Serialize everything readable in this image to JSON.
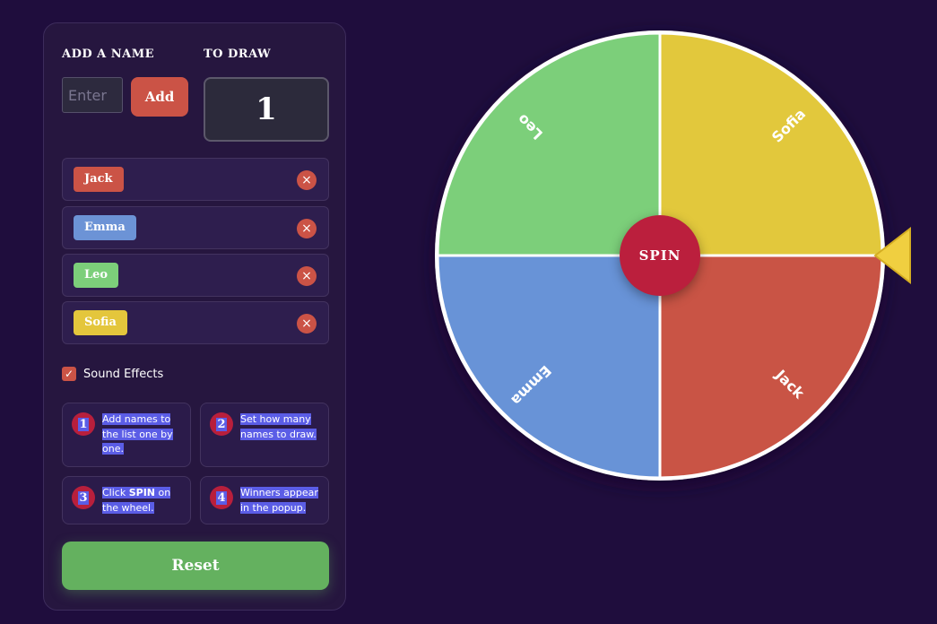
{
  "form": {
    "add_label": "ADD A NAME",
    "input_placeholder": "Enter",
    "input_value": "",
    "add_button": "Add",
    "draw_label": "TO DRAW",
    "draw_count": "1"
  },
  "names": [
    {
      "name": "Jack",
      "color": "#cb5346"
    },
    {
      "name": "Emma",
      "color": "#6c93d6"
    },
    {
      "name": "Leo",
      "color": "#7ccf7a"
    },
    {
      "name": "Sofia",
      "color": "#e4c63c"
    }
  ],
  "delete_glyph": "×",
  "sound_effects": {
    "label": "Sound Effects",
    "checked": true
  },
  "steps": [
    {
      "num": "1",
      "text": "Add names to the list one by one."
    },
    {
      "num": "2",
      "text": "Set how many names to draw."
    },
    {
      "num": "3",
      "text_pre": "Click ",
      "text_bold": "SPIN",
      "text_post": " on the wheel."
    },
    {
      "num": "4",
      "text": "Winners appear in the popup."
    }
  ],
  "reset_button": "Reset",
  "wheel": {
    "segments": [
      {
        "name": "Sofia",
        "color": "#e2c83c"
      },
      {
        "name": "Jack",
        "color": "#c95445"
      },
      {
        "name": "Emma",
        "color": "#6893d7"
      },
      {
        "name": "Leo",
        "color": "#7ccf7a"
      }
    ],
    "spin_label": "SPIN",
    "pointer_color": "#f0cf40"
  }
}
